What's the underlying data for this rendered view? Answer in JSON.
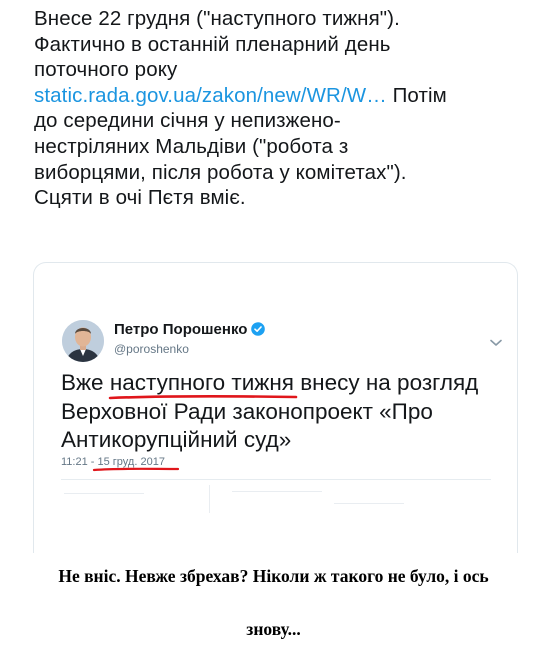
{
  "tweet": {
    "line1": "Внесе 22 грудня (\"наступного тижня\").",
    "line2": "Фактично в останній пленарний день",
    "line3": "поточного року",
    "link": "static.rada.gov.ua/zakon/new/WR/W…",
    "after_link": " Потім",
    "line5": "до середини січня у непизжено-",
    "line6": "нестріляних Мальдіви (\"робота з",
    "line7": "виборцями, після робота у комітетах\").",
    "line8": "Сцяти в очі Пєтя вміє."
  },
  "quoted_tweet": {
    "author_name": "Петро Порошенко",
    "handle": "@poroshenko",
    "text_start": "Вже ",
    "text_underlined": "наступного тижня",
    "text_rest": " внесу на розгляд Верховної Ради законопроект «Про Антикорупційний суд»",
    "time": "11:21",
    "separator": " - ",
    "date": "15 груд. 2017",
    "underline_color": "#e0161b",
    "verified_color": "#1da1f2",
    "link_color": "#1b95e0"
  },
  "caption": {
    "line1": "Не вніс. Невже збрехав? Ніколи ж такого не було, і ось",
    "line2": "знову..."
  }
}
